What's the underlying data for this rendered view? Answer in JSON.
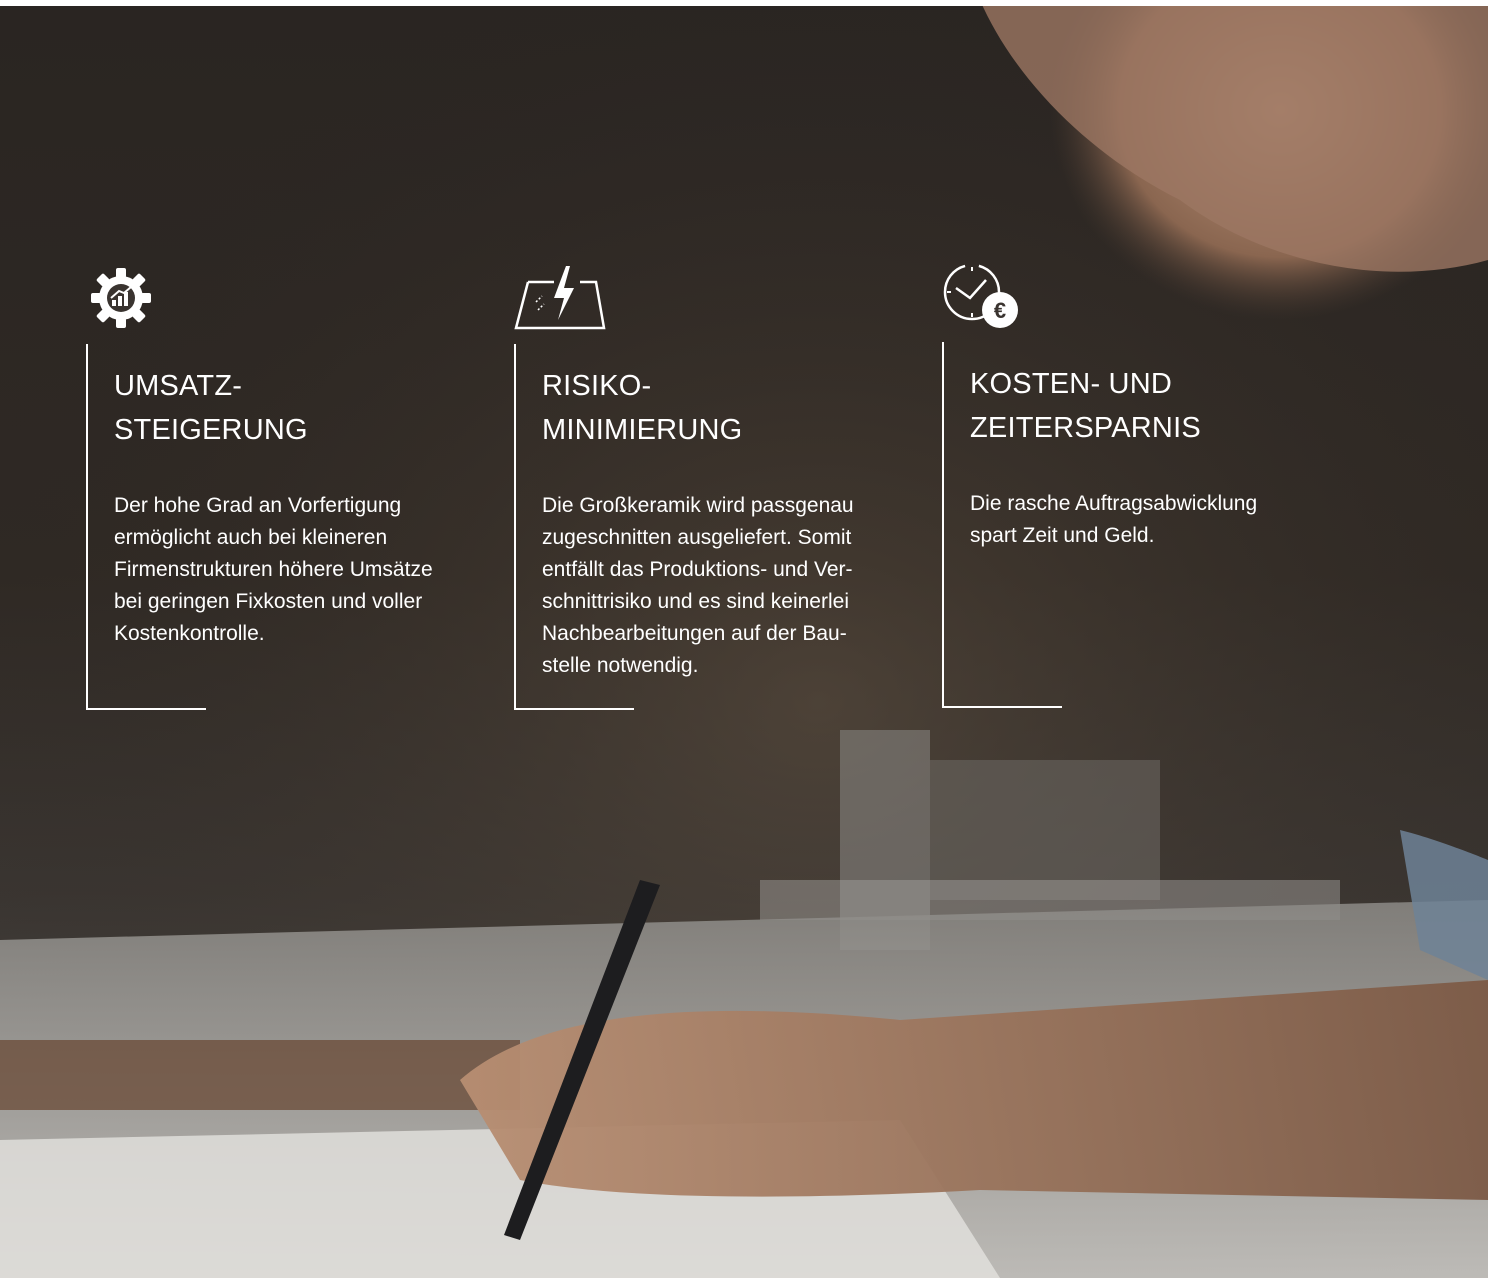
{
  "features": [
    {
      "icon": "gear-chart-icon",
      "title": "UMSATZ-\nSTEIGERUNG",
      "text": "Der hohe Grad an Vorfertigung\nermöglicht auch bei kleineren\nFirmenstrukturen höhere Umsätze\nbei geringen Fixkosten und voller\nKostenkontrolle."
    },
    {
      "icon": "glass-lightning-icon",
      "title": "RISIKO-\nMINIMIERUNG",
      "text": "Die Großkeramik wird passgenau\nzugeschnitten ausgeliefert. Somit\nentfällt das Produktions- und Ver-\nschnittrisiko und es sind keinerlei\nNachbearbeitungen auf der Bau-\nstelle notwendig."
    },
    {
      "icon": "clock-euro-icon",
      "title": "KOSTEN- UND\nZEITERSPARNIS",
      "text": "Die rasche Auftragsabwicklung\nspart Zeit und Geld."
    }
  ],
  "colors": {
    "text": "#ffffff",
    "background": "#2b2623"
  }
}
